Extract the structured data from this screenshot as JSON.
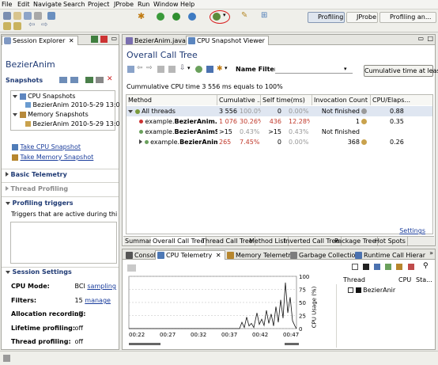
{
  "menu": [
    "File",
    "Edit",
    "Navigate",
    "Search",
    "Project",
    "JProbe",
    "Run",
    "Window",
    "Help"
  ],
  "perspectives": {
    "profiling": "Profiling",
    "jprobe": "JProbe",
    "profiling_an": "Profiling an..."
  },
  "left_panel": {
    "tab_label": "Session Explorer",
    "tab_close": "✕",
    "title": "BezierAnim",
    "snapshots_header": "Snapshots",
    "tree": {
      "cpu_snapshots": "CPU Snapshots",
      "cpu_item": "BezierAnim 2010-5-29 13:0",
      "memory_snapshots": "Memory Snapshots",
      "memory_item": "BezierAnim 2010-5-29 13:0"
    },
    "take_cpu": "Take CPU Snapshot",
    "take_memory": "Take Memory Snapshot",
    "basic_telemetry": "Basic Telemetry",
    "thread_profiling": "Thread Profiling",
    "profiling_triggers": "Profiling triggers",
    "triggers_text": "Triggers that are active during this sess",
    "session_settings": "Session Settings",
    "settings": [
      {
        "label": "CPU Mode:",
        "value": "BCI",
        "link": "sampling"
      },
      {
        "label": "Filters:",
        "value": "15",
        "link": "manage"
      },
      {
        "label": "Allocation recording:",
        "value": "off",
        "link": ""
      },
      {
        "label": "Lifetime profiling:",
        "value": "off",
        "link": ""
      },
      {
        "label": "Thread profiling:",
        "value": "off",
        "link": ""
      }
    ]
  },
  "editor": {
    "tabs": [
      "BezierAnim.java",
      "CPU Snapshot Viewer"
    ],
    "title": "Overall Call Tree",
    "name_filter_label": "Name Filter:",
    "cumulative_button": "Cumulative time at least",
    "cumulative_note": "Cummulative CPU time 3 556 ms equals to 100%",
    "columns": [
      "Method",
      "Cumulative ...",
      "Self time(ms)",
      "Invocation Count",
      "CPU/Elaps..."
    ],
    "rows": [
      {
        "method_prefix": "",
        "method_bold": "All threads",
        "cum": "3 556",
        "cum_pct": "100.0%",
        "self": "0",
        "self_pct": "0.00%",
        "count": "Not finished",
        "ratio": "0.88",
        "cum_red": false,
        "self_red": false
      },
      {
        "method_prefix": "example.",
        "method_bold": "BezierAnim.m",
        "cum": "1 076",
        "cum_pct": "30.26%",
        "self": "436",
        "self_pct": "12.28%",
        "count": "1",
        "ratio": "0.35",
        "cum_red": true,
        "self_red": true
      },
      {
        "method_prefix": "example.",
        "method_bold": "BezierAnimSC",
        "cum": ">15",
        "cum_pct": "0.43%",
        "self": ">15",
        "self_pct": "0.43%",
        "count": "Not finished",
        "ratio": "",
        "cum_red": false,
        "self_red": false
      },
      {
        "method_prefix": "example.",
        "method_bold": "BezierAnimSC",
        "cum": "265",
        "cum_pct": "7.45%",
        "self": "0",
        "self_pct": "0.00%",
        "count": "368",
        "ratio": "0.26",
        "cum_red": true,
        "self_red": false
      }
    ],
    "settings_link": "Settings",
    "bottom_tabs": [
      "Summary",
      "Overall Call Tree",
      "Thread Call Tree",
      "Method List",
      "Inverted Call Tree",
      "Package Tree",
      "Hot Spots"
    ]
  },
  "bottom_panel": {
    "tabs": [
      "Console",
      "CPU Telemetry",
      "Memory Telemetry",
      "Garbage Collection",
      "Runtime Call Hierar"
    ],
    "y_axis_label": "CPU Usage (%)",
    "y_ticks": [
      "100",
      "75",
      "50",
      "25",
      "0"
    ],
    "x_ticks": [
      "00:22",
      "00:27",
      "00:32",
      "00:37",
      "00:42",
      "00:47"
    ],
    "thread_col": "Thread",
    "cpu_col": "CPU",
    "sta_col": "Sta...",
    "thread_name": "BezierAnir"
  },
  "colors": {
    "accent_blue": "#1f3a74",
    "red_value": "#c0392b",
    "highlight_circle": "#d81e1e"
  }
}
